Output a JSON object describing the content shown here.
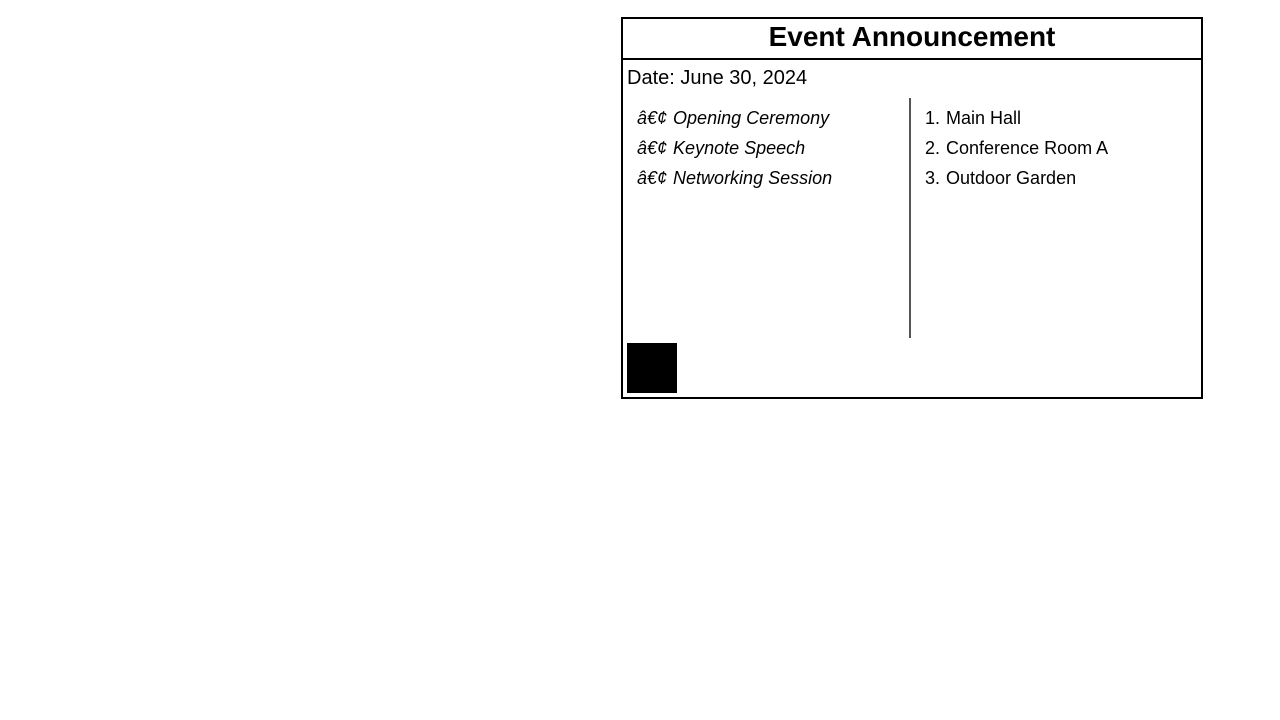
{
  "announcement": {
    "title": "Event Announcement",
    "date_text": "Date: June 30, 2024",
    "activities": [
      {
        "bullet": "â€¢",
        "label": "Opening Ceremony"
      },
      {
        "bullet": "â€¢",
        "label": "Keynote Speech"
      },
      {
        "bullet": "â€¢",
        "label": "Networking Session"
      }
    ],
    "venues": [
      {
        "number": "1.",
        "label": "Main Hall"
      },
      {
        "number": "2.",
        "label": "Conference Room A"
      },
      {
        "number": "3.",
        "label": "Outdoor Garden"
      }
    ],
    "colors": {
      "border": "#000000",
      "divider": "#555555",
      "square": "#000000"
    }
  }
}
